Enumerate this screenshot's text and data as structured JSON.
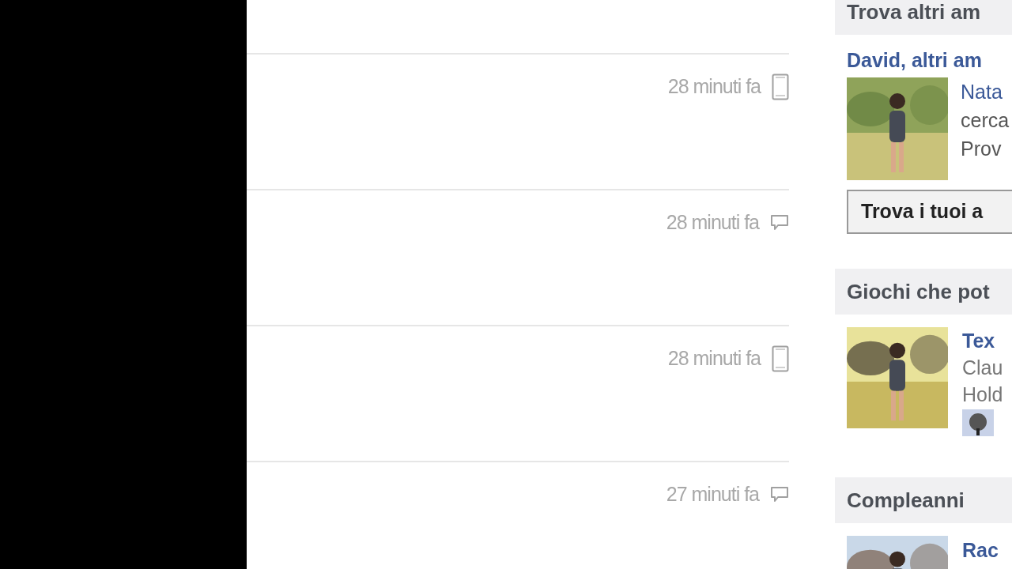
{
  "feed": {
    "items": [
      {
        "time": "28 minuti fa",
        "kind": "mobile"
      },
      {
        "time": "28 minuti fa",
        "kind": "comment"
      },
      {
        "time": "28 minuti fa",
        "kind": "mobile"
      },
      {
        "time": "27 minuti fa",
        "kind": "comment"
      }
    ]
  },
  "sidebar": {
    "find_friends": {
      "heading": "Trova altri am",
      "title": "David, altri am",
      "lines": [
        "Nata",
        "cerca",
        "Prov"
      ],
      "button": "Trova i tuoi a"
    },
    "games": {
      "heading": "Giochi che pot",
      "title": "Tex",
      "lines": [
        "Clau",
        "Hold"
      ]
    },
    "birthdays": {
      "heading": "Compleanni",
      "title": "Rac"
    }
  }
}
